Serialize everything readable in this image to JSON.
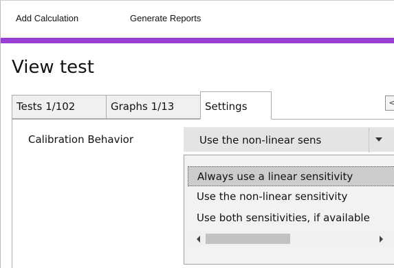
{
  "menu": {
    "items": [
      {
        "label": "Add Calculation"
      },
      {
        "label": "Generate Reports"
      }
    ]
  },
  "colors": {
    "accent": "#9b3fd4",
    "selected_option_bg": "#cccccc"
  },
  "page": {
    "title": "View test"
  },
  "tabs": [
    {
      "label": "Tests 1/102",
      "selected": false
    },
    {
      "label": "Graphs 1/13",
      "selected": false
    },
    {
      "label": "Settings",
      "selected": true
    }
  ],
  "tab_scroll": {
    "icon": "scroll-left-icon",
    "glyph": "<"
  },
  "settings": {
    "calibration_label": "Calibration Behavior",
    "calibration_value": "Use the non-linear sens",
    "dropdown_icon": "chevron-down-icon",
    "options": [
      {
        "label": "Always use a linear sensitivity",
        "highlighted": true
      },
      {
        "label": "Use the non-linear sensitivity",
        "highlighted": false
      },
      {
        "label": "Use both sensitivities, if available",
        "highlighted": false
      }
    ],
    "scrollbar": {
      "left_icon": "arrow-left-icon",
      "right_icon": "arrow-right-icon",
      "scroll_fraction": 0.0
    }
  }
}
